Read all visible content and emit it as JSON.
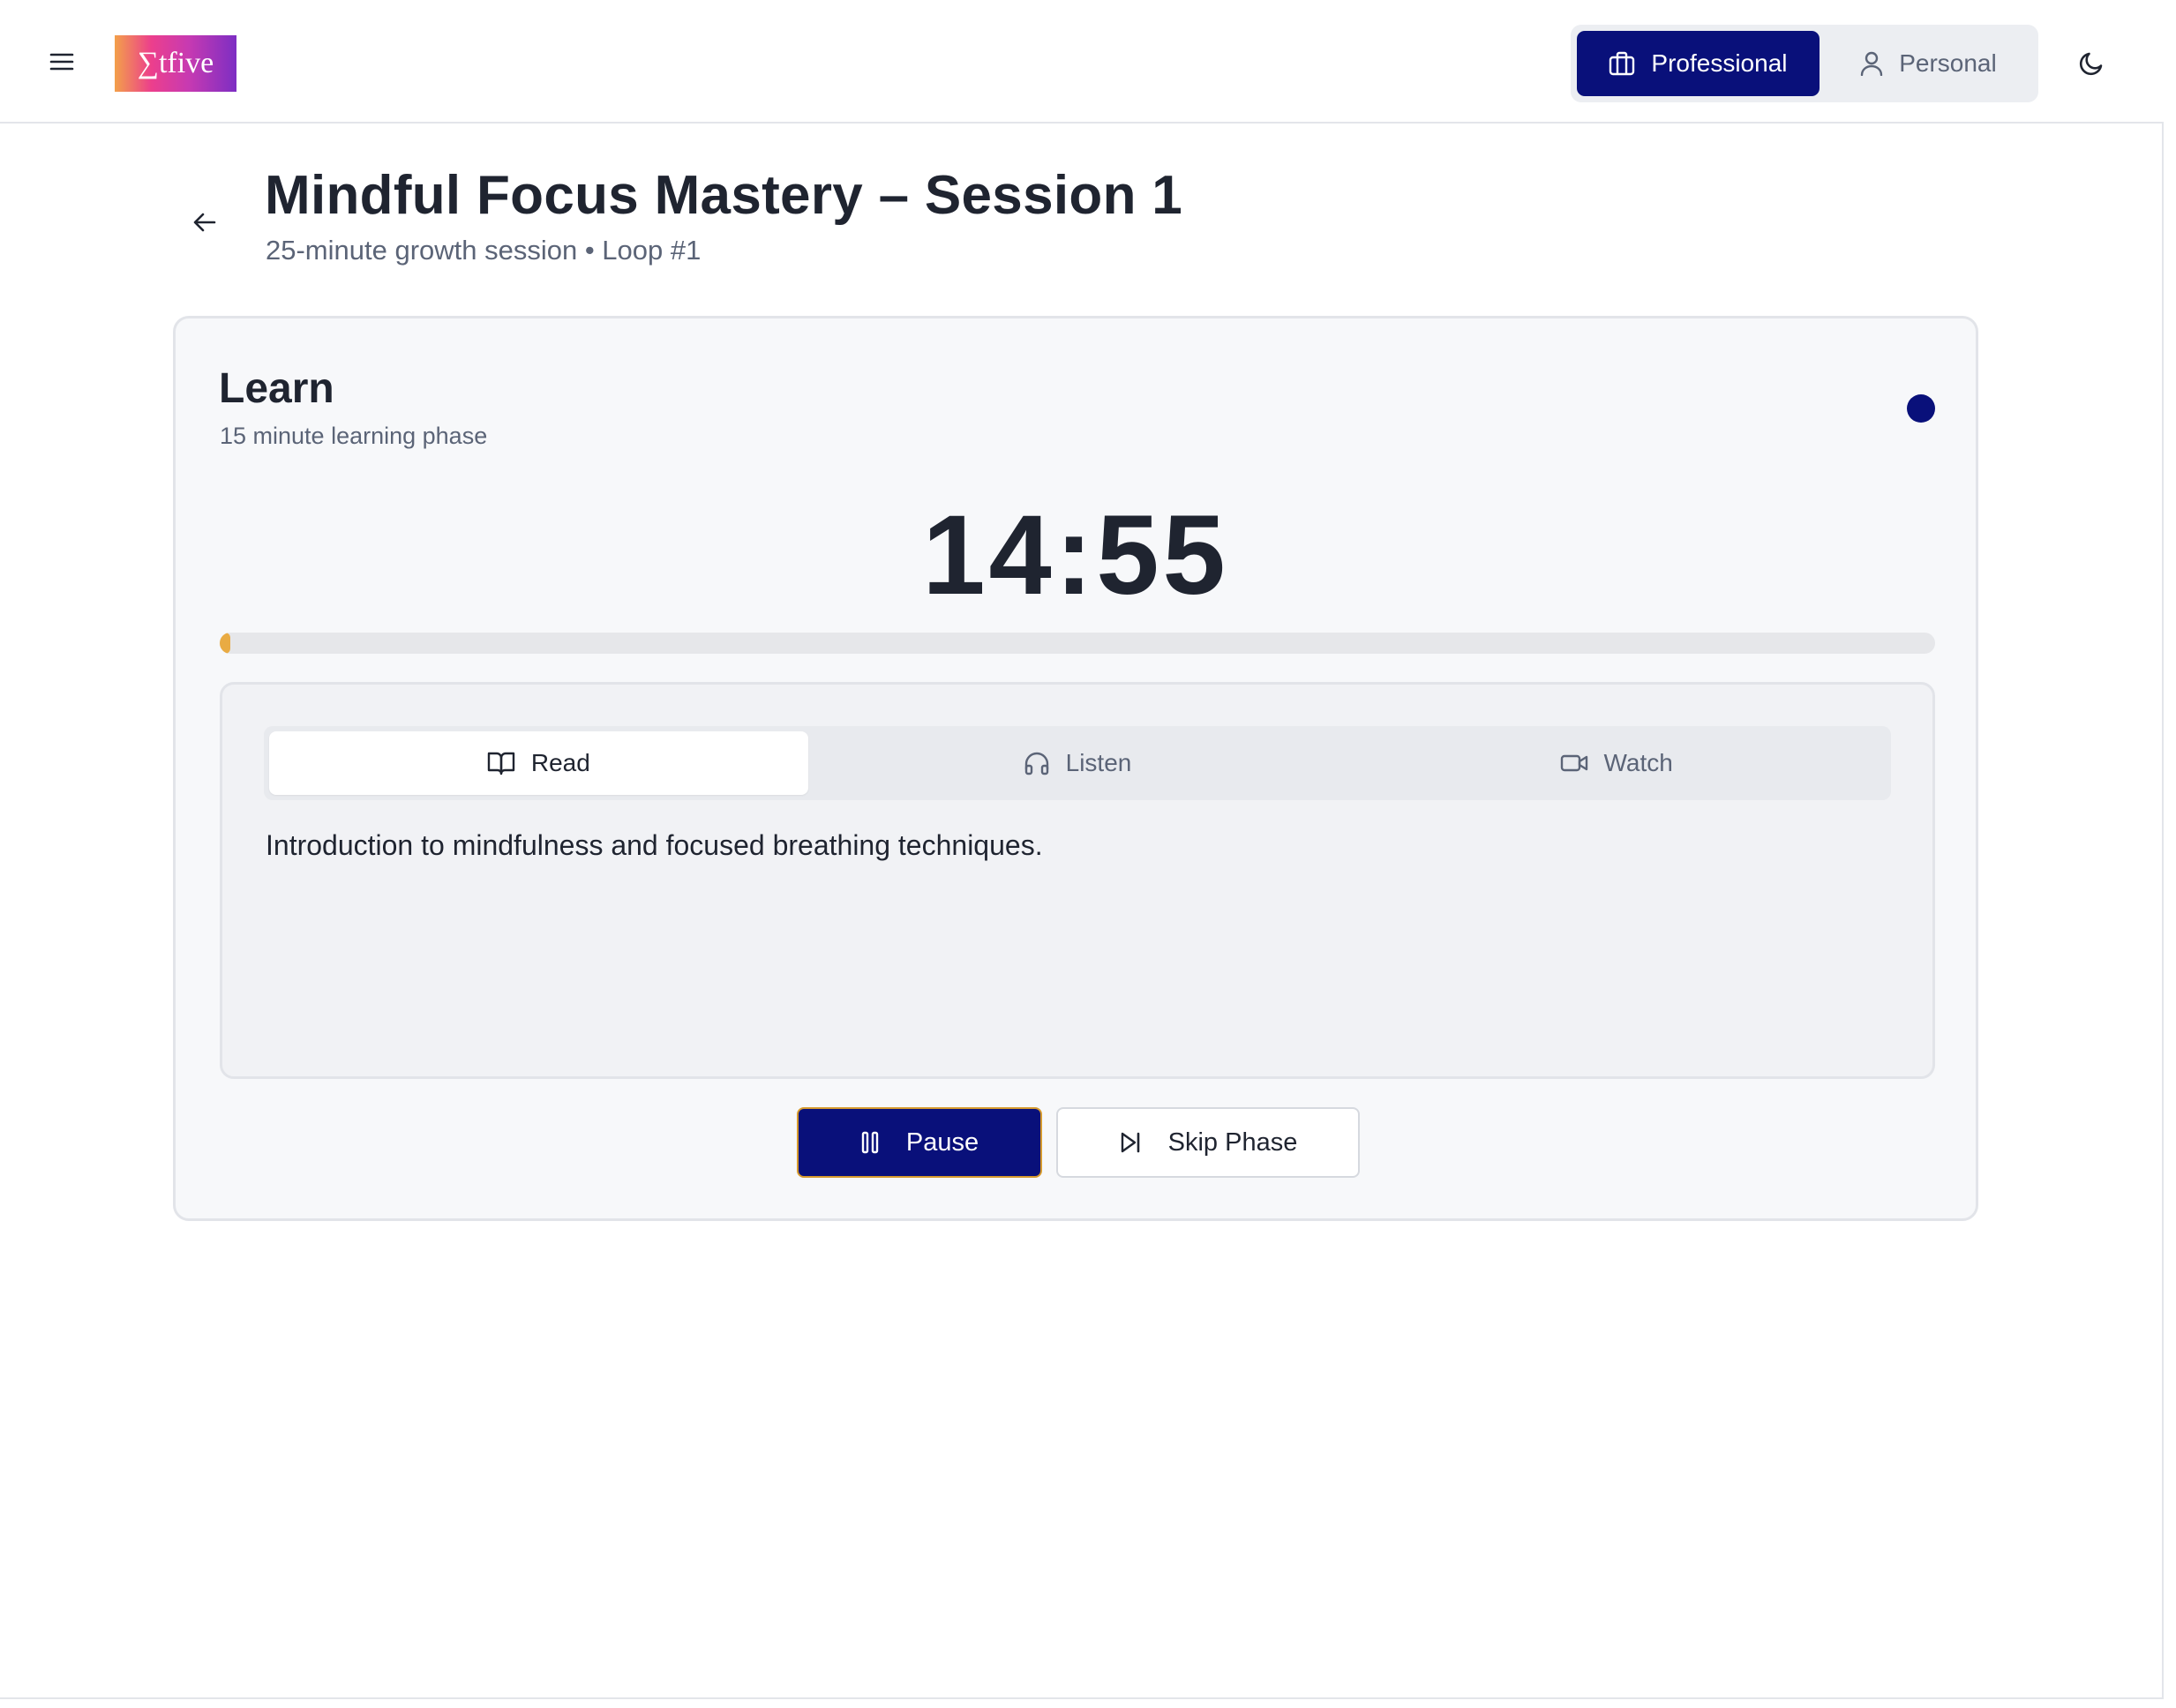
{
  "header": {
    "logo_text": "∑tfive",
    "modes": [
      {
        "label": "Professional",
        "icon": "briefcase-icon",
        "active": true
      },
      {
        "label": "Personal",
        "icon": "user-icon",
        "active": false
      }
    ],
    "menu_icon": "hamburger-menu-icon",
    "theme_icon": "moon-icon"
  },
  "page": {
    "title": "Mindful Focus Mastery – Session 1",
    "subtitle": "25-minute growth session • Loop #1",
    "back_icon": "arrow-left-icon"
  },
  "phase": {
    "title": "Learn",
    "description": "15 minute learning phase",
    "timer": "14:55",
    "progress_fraction": 0.006,
    "status_color": "#09107a",
    "progress_color": "#e9ab43"
  },
  "content": {
    "tabs": [
      {
        "label": "Read",
        "icon": "book-open-icon",
        "active": true
      },
      {
        "label": "Listen",
        "icon": "headphones-icon",
        "active": false
      },
      {
        "label": "Watch",
        "icon": "video-camera-icon",
        "active": false
      }
    ],
    "text": "Introduction to mindfulness and focused breathing techniques."
  },
  "controls": {
    "pause_label": "Pause",
    "skip_label": "Skip Phase",
    "pause_icon": "pause-icon",
    "skip_icon": "skip-forward-icon"
  },
  "colors": {
    "accent": "#09107a",
    "highlight": "#e9ab43"
  }
}
